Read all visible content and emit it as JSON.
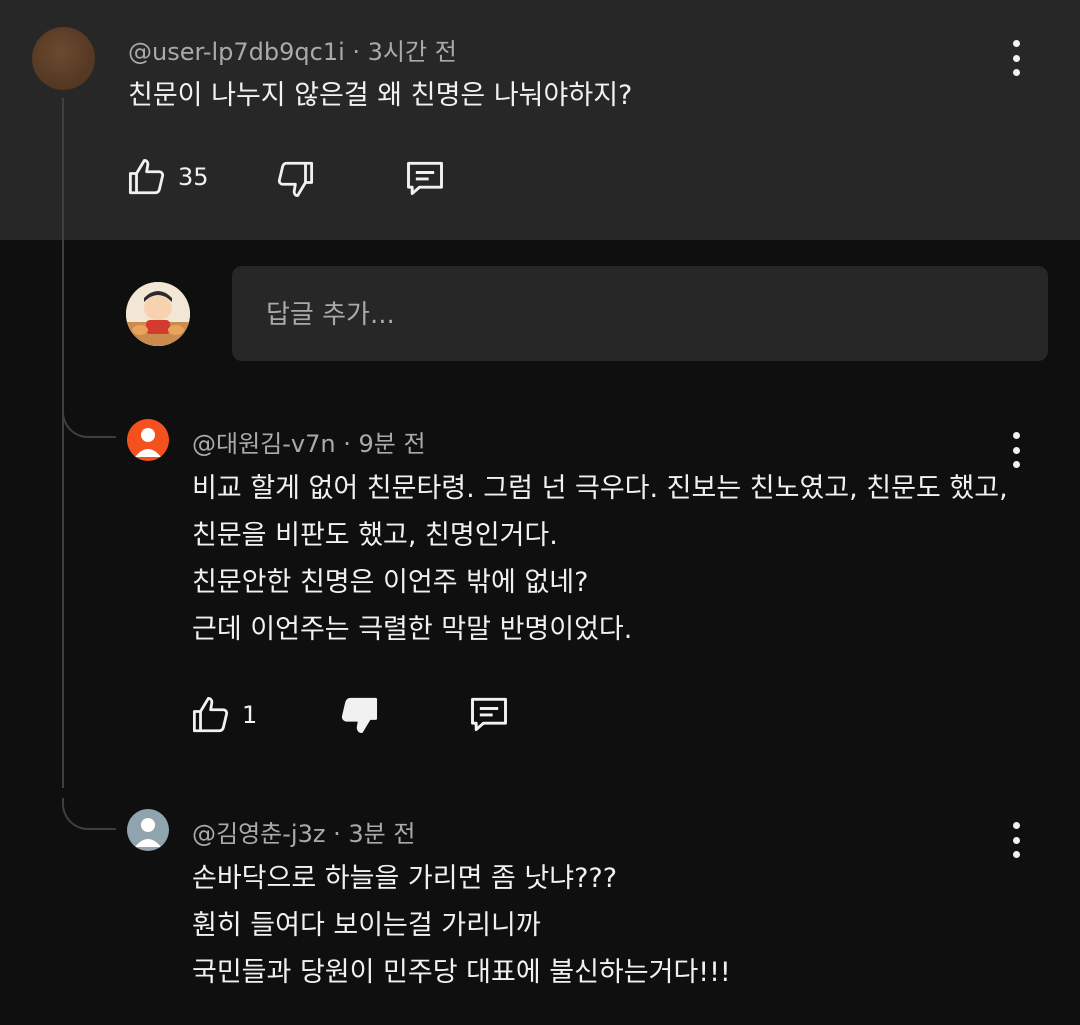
{
  "comments": [
    {
      "handle": "@user-lp7db9qc1i",
      "time": "· 3시간 전",
      "lines": [
        "친문이 나누지 않은걸 왜 친명은 나눠야하지?"
      ],
      "likes": "35"
    },
    {
      "handle": "@대원김-v7n",
      "time": "· 9분 전",
      "lines": [
        "비교 할게 없어 친문타령. 그럼 넌 극우다. 진보는 친노였고, 친문도 했고,",
        "친문을 비판도 했고, 친명인거다.",
        "친문안한 친명은 이언주 밖에 없네?",
        "근데 이언주는 극렬한 막말 반명이었다."
      ],
      "likes": "1"
    },
    {
      "handle": "@김영춘-j3z",
      "time": "· 3분 전",
      "lines": [
        "손바닥으로 하늘을 가리면 좀 낫냐???",
        "훤히 들여다 보이는걸 가리니까",
        "국민들과 당원이 민주당 대표에 불신하는거다!!!"
      ]
    }
  ],
  "reply_input": {
    "placeholder": "답글 추가..."
  },
  "colors": {
    "top_bg": "#272727",
    "page_bg": "#0f0f0f",
    "text": "#f1f1f1",
    "secondary": "#aaaaaa",
    "avatar_orange": "#f4511e",
    "avatar_gray": "#90a4ae",
    "avatar_brown": "#5a3b25"
  },
  "icons": [
    "like-icon",
    "dislike-icon",
    "reply-icon",
    "more-vert-icon",
    "person-icon"
  ]
}
